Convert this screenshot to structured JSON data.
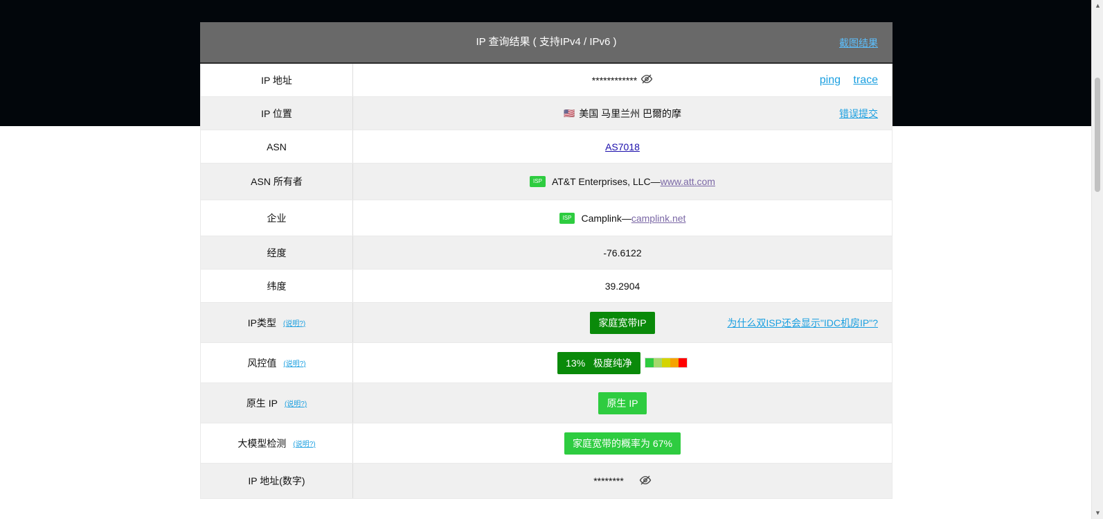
{
  "header": {
    "title": "IP 查询结果 ( 支持IPv4 / IPv6 )",
    "screenshot_link": "截图结果"
  },
  "rows": {
    "ip_address": {
      "label": "IP 地址",
      "value": "************",
      "icon": "eye-slash-icon",
      "ping": "ping",
      "trace": "trace"
    },
    "ip_location": {
      "label": "IP 位置",
      "flag": "🇺🇸",
      "value": "美国 马里兰州 巴爾的摩",
      "report": "错误提交"
    },
    "asn": {
      "label": "ASN",
      "value": "AS7018"
    },
    "asn_owner": {
      "label": "ASN 所有者",
      "badge": "ISP",
      "name": "AT&T Enterprises, LLC—",
      "site": "www.att.com"
    },
    "enterprise": {
      "label": "企业",
      "badge": "ISP",
      "name": "Camplink—",
      "site": "camplink.net"
    },
    "longitude": {
      "label": "经度",
      "value": "-76.6122"
    },
    "latitude": {
      "label": "纬度",
      "value": "39.2904"
    },
    "ip_type": {
      "label": "IP类型",
      "explain": "(说明?)",
      "value": "家庭宽带IP",
      "note": "为什么双ISP还会显示\"IDC机房IP\"?"
    },
    "risk": {
      "label": "风控值",
      "explain": "(说明?)",
      "value": "13%   极度纯净",
      "scale_colors": [
        "#2ecc40",
        "#a5d86b",
        "#d4d400",
        "#f5a300",
        "#ff0000"
      ]
    },
    "native_ip": {
      "label": "原生 IP",
      "explain": "(说明?)",
      "value": "原生 IP"
    },
    "llm_detect": {
      "label": "大模型检测",
      "explain": "(说明?)",
      "value": "家庭宽带的概率为 67%"
    },
    "ip_numeric": {
      "label": "IP 地址(数字)",
      "value": "********",
      "icon": "eye-slash-icon"
    }
  },
  "colors": {
    "header_bg": "#696969",
    "badge_dark": "#0a8a0a",
    "badge_light": "#2ecc40",
    "link": "#1a9fe0"
  }
}
